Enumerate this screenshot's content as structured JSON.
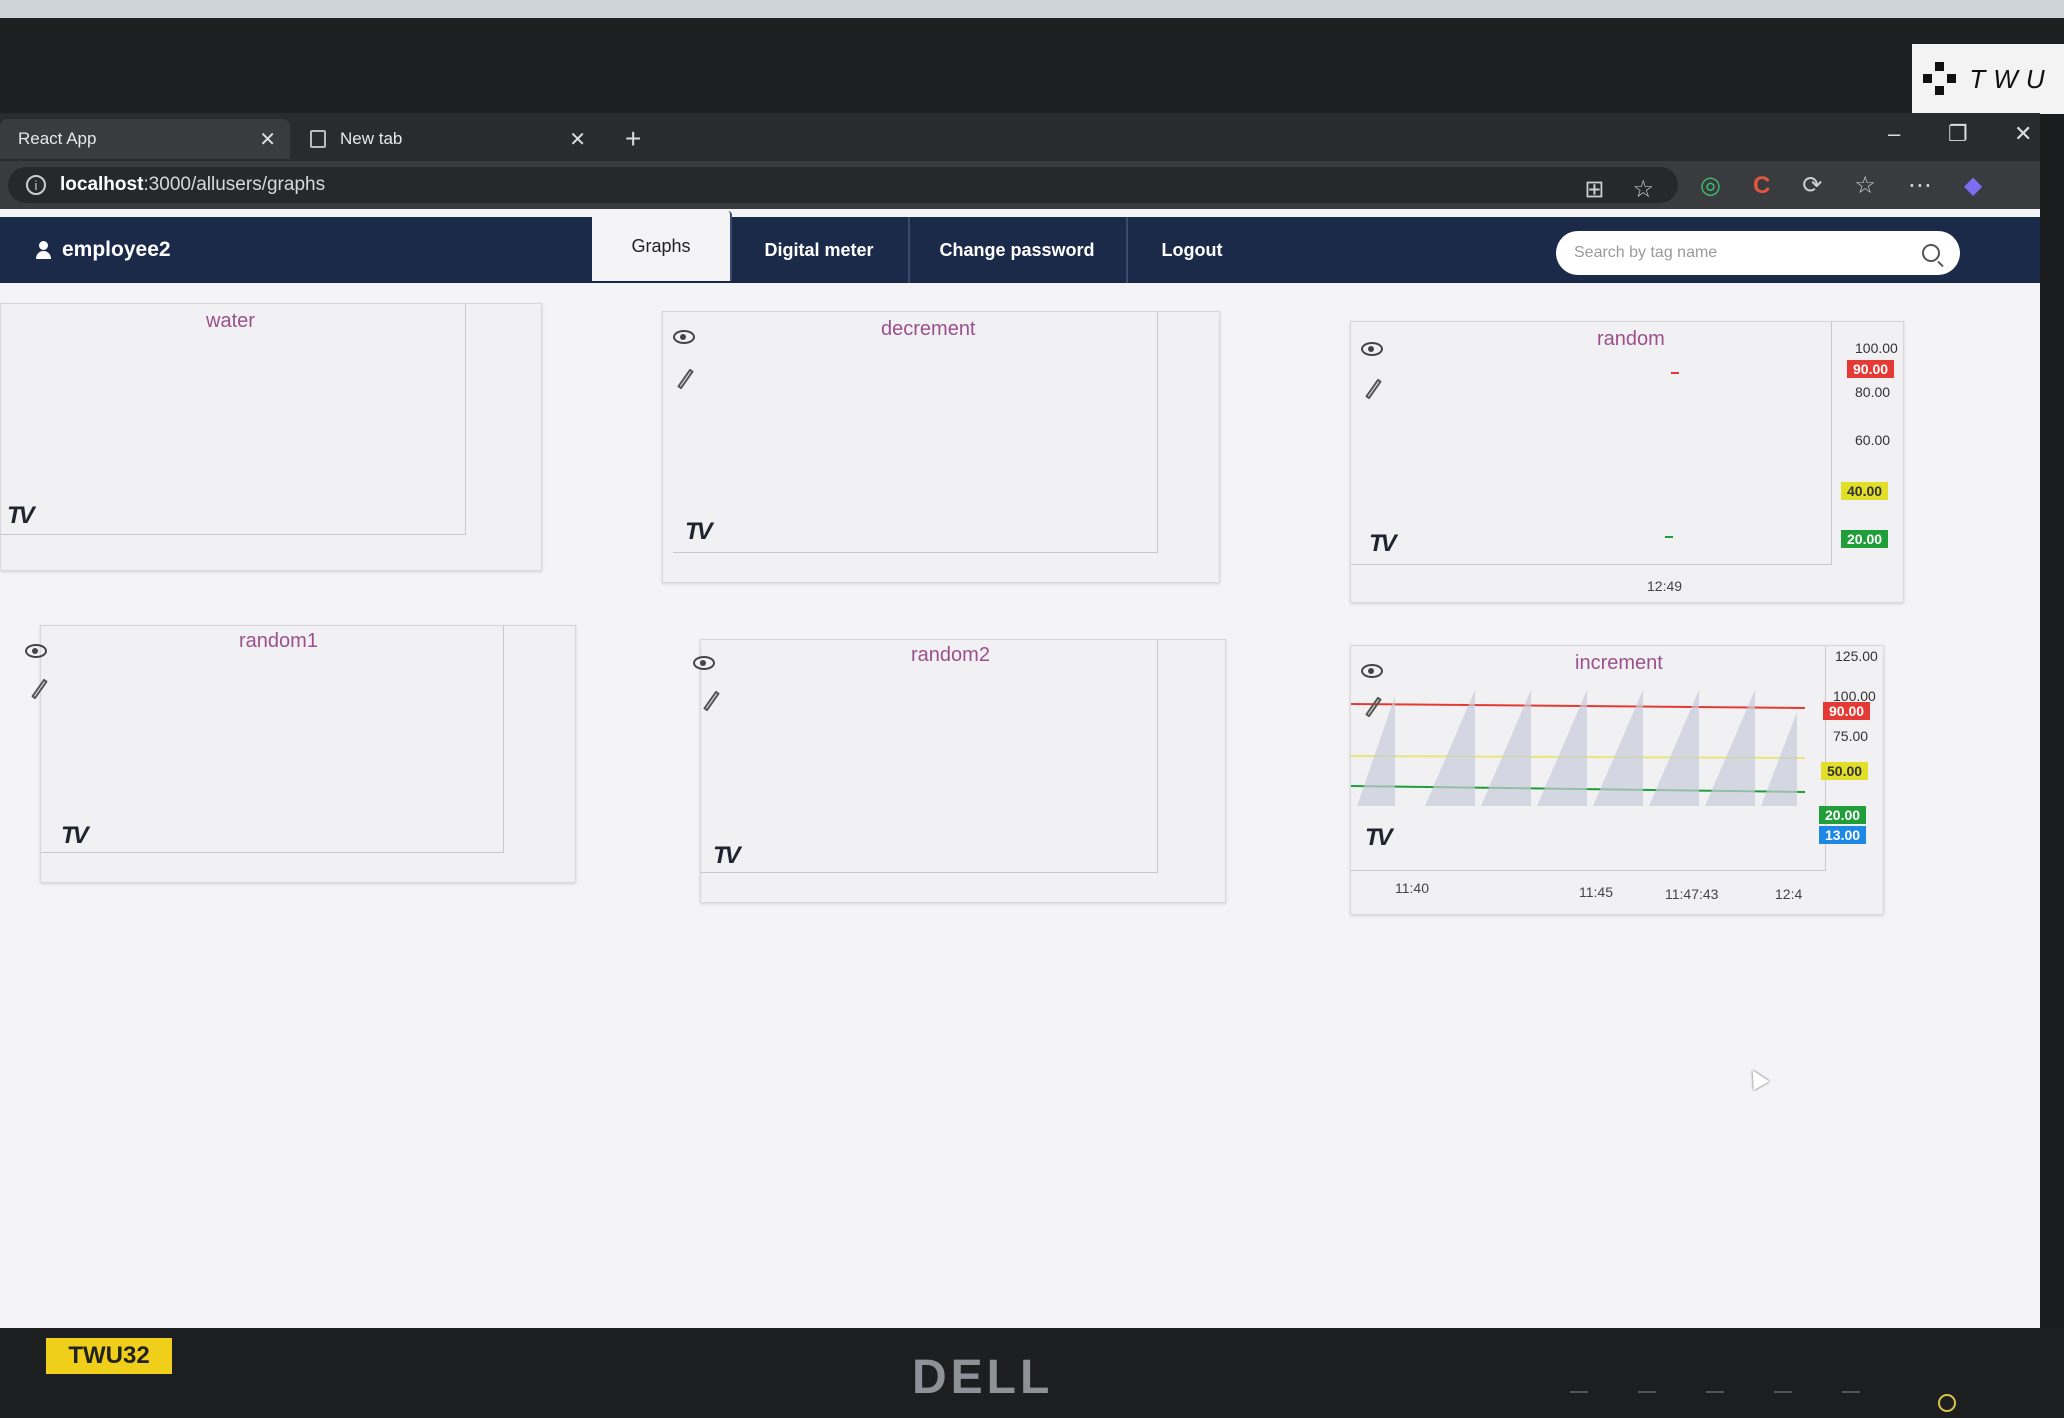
{
  "browser": {
    "tabs": [
      {
        "label": "React App"
      },
      {
        "label": "New tab"
      }
    ],
    "new_tab_symbol": "+",
    "url_host": "localhost",
    "url_path": ":3000/allusers/graphs",
    "window_controls": [
      "–",
      "❐",
      "✕"
    ]
  },
  "app": {
    "username": "employee2",
    "nav": [
      {
        "label": "Graphs",
        "active": true
      },
      {
        "label": "Digital meter"
      },
      {
        "label": "Change password"
      },
      {
        "label": "Logout"
      }
    ],
    "search": {
      "placeholder": "Search by tag name",
      "value": ""
    }
  },
  "cards": [
    {
      "title": "water"
    },
    {
      "title": "decrement"
    },
    {
      "title": "random"
    },
    {
      "title": "random1"
    },
    {
      "title": "random2"
    },
    {
      "title": "increment"
    }
  ],
  "random_chart": {
    "y_ticks": [
      "100.00",
      "80.00",
      "60.00"
    ],
    "thresholds": [
      {
        "value": "90.00",
        "color": "#e53935"
      },
      {
        "value": "40.00",
        "color": "#e2df2a"
      },
      {
        "value": "20.00",
        "color": "#1f9e3a"
      }
    ],
    "x_label": "12:49"
  },
  "increment_chart": {
    "y_ticks": [
      "125.00",
      "100.00",
      "75.00"
    ],
    "thresholds": [
      {
        "value": "90.00",
        "color": "#e53935"
      },
      {
        "value": "50.00",
        "color": "#e2df2a"
      },
      {
        "value": "20.00",
        "color": "#1f9e3a"
      },
      {
        "value": "13.00",
        "color": "#1e88e5"
      }
    ],
    "x_labels": [
      "11:40",
      "11:45",
      "11:47:43",
      "12:4"
    ]
  },
  "monitor": {
    "asset_tag": "TWU32",
    "brand": "DELL",
    "sticker": "TWU"
  },
  "colors": {
    "nav_bg": "#1c2a4a",
    "title_color": "#9b4f8c",
    "page_bg": "#f4f4f6"
  }
}
